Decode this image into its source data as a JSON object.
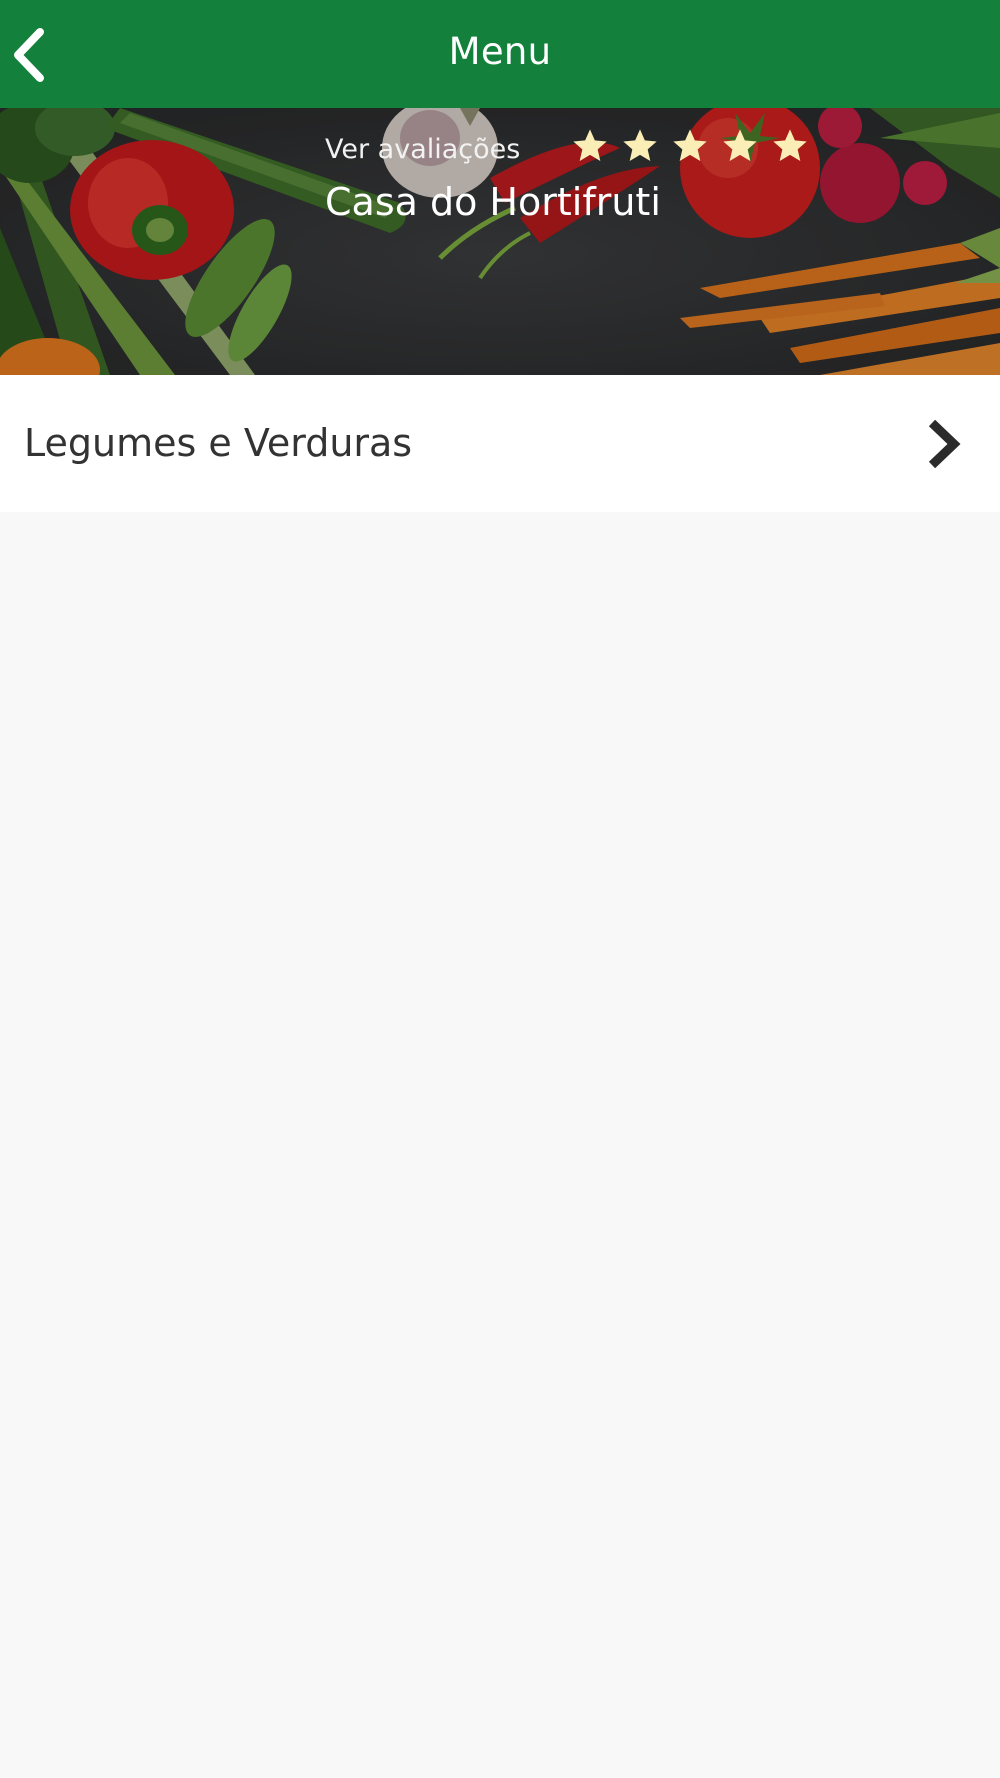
{
  "header": {
    "title": "Menu",
    "back_icon": "chevron-left-icon",
    "background_color": "#13803b"
  },
  "store": {
    "reviews_link": "Ver avaliações",
    "name": "Casa do Hortifruti",
    "rating": 5,
    "rating_max": 5,
    "star_color": "#fbedb6"
  },
  "categories": [
    {
      "label": "Legumes e Verduras",
      "icon": "chevron-right-icon"
    }
  ]
}
